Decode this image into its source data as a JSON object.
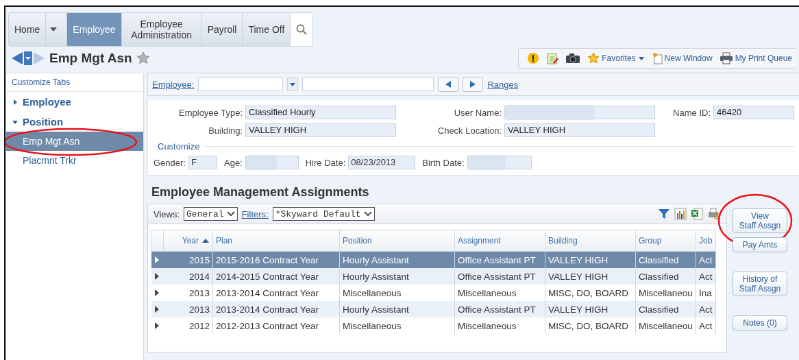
{
  "nav": {
    "tabs": [
      {
        "label": "Home",
        "selected": false,
        "caret": true
      },
      {
        "label": "Employee",
        "selected": true
      },
      {
        "label": "Employee Administration",
        "selected": false
      },
      {
        "label": "Payroll",
        "selected": false
      },
      {
        "label": "Time Off",
        "selected": false
      }
    ]
  },
  "page_title": "Emp Mgt Asn",
  "toolbar": [
    {
      "kind": "alert"
    },
    {
      "kind": "notepad"
    },
    {
      "kind": "camera"
    },
    {
      "kind": "favorites",
      "label": "Favorites"
    },
    {
      "kind": "new-window",
      "label": "New Window"
    },
    {
      "kind": "print",
      "label": "My Print Queue"
    }
  ],
  "sidebar": {
    "customize": "Customize Tabs",
    "groups": [
      {
        "label": "Employee",
        "expanded": false
      },
      {
        "label": "Position",
        "expanded": true,
        "items": [
          {
            "label": "Emp Mgt Asn",
            "selected": true,
            "circled": true
          },
          {
            "label": "Placmnt Trkr",
            "selected": false,
            "circled": false
          }
        ]
      }
    ]
  },
  "employee_bar": {
    "label": "Employee:",
    "ranges": "Ranges"
  },
  "details": {
    "rows": [
      [
        {
          "label": "Employee Type:",
          "value": "Classified Hourly"
        },
        {
          "label": "User Name:",
          "redacted": true
        },
        {
          "label": "Name ID:",
          "value": "46420"
        }
      ],
      [
        {
          "label": "Building:",
          "value": "VALLEY HIGH"
        },
        {
          "label": "Check Location:",
          "value": "VALLEY HIGH"
        }
      ]
    ],
    "customize": "Customize",
    "small": [
      {
        "label": "Gender:",
        "value": "F"
      },
      {
        "label": "Age:",
        "redacted": true
      },
      {
        "label": "Hire Date:",
        "value": "08/23/2013"
      },
      {
        "label": "Birth Date:",
        "redacted": true
      }
    ]
  },
  "grid": {
    "title": "Employee Management Assignments",
    "views_label": "Views:",
    "views_value": "General",
    "filters_label": "Filters:",
    "filters_value": "*Skyward Default",
    "columns": [
      {
        "label": "Year",
        "sorted_ascending": true
      },
      {
        "label": "Plan",
        "sorted_ascending": false
      },
      {
        "label": "Position",
        "sorted_ascending": false
      },
      {
        "label": "Assignment",
        "sorted_ascending": false
      },
      {
        "label": "Building",
        "sorted_ascending": false
      },
      {
        "label": "Group",
        "sorted_ascending": false
      },
      {
        "label": "Job",
        "sorted_ascending": false
      }
    ],
    "rows": [
      {
        "selected": true,
        "cells": [
          "2015",
          "2015-2016 Contract Year",
          "Hourly Assistant",
          "Office Assistant PT",
          "VALLEY HIGH",
          "Classified",
          "Act"
        ]
      },
      {
        "selected": false,
        "cells": [
          "2014",
          "2014-2015 Contract Year",
          "Hourly Assistant",
          "Office Assistant PT",
          "VALLEY HIGH",
          "Classified",
          "Act"
        ]
      },
      {
        "selected": false,
        "cells": [
          "2013",
          "2013-2014 Contract Year",
          "Miscellaneous",
          "Miscellaneous",
          "MISC, DO, BOARD",
          "Miscellaneou",
          "Ina"
        ]
      },
      {
        "selected": false,
        "cells": [
          "2013",
          "2013-2014 Contract Year",
          "Hourly Assistant",
          "Office Assistant PT",
          "VALLEY HIGH",
          "Classified",
          "Act"
        ]
      },
      {
        "selected": false,
        "cells": [
          "2012",
          "2012-2013 Contract Year",
          "Miscellaneous",
          "Miscellaneous",
          "MISC, DO, BOARD",
          "Miscellaneou",
          "Act"
        ]
      }
    ]
  },
  "side_buttons": [
    {
      "lines": [
        "View",
        "Staff Assgn"
      ],
      "circled": true
    },
    {
      "lines": [
        "Pay Amts"
      ],
      "circled": false
    },
    {
      "lines": [
        "History of",
        "Staff Assgn"
      ],
      "circled": false
    },
    {
      "lines": [
        "Notes (0)"
      ],
      "circled": false
    }
  ]
}
